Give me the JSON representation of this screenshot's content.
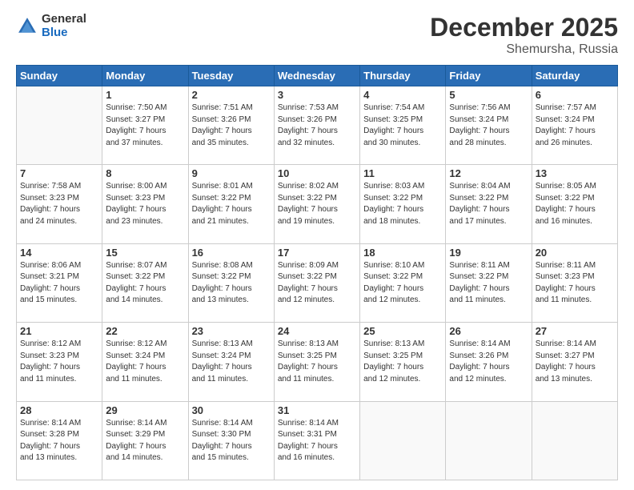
{
  "header": {
    "logo": {
      "general": "General",
      "blue": "Blue"
    },
    "title": "December 2025",
    "location": "Shemursha, Russia"
  },
  "weekdays": [
    "Sunday",
    "Monday",
    "Tuesday",
    "Wednesday",
    "Thursday",
    "Friday",
    "Saturday"
  ],
  "weeks": [
    [
      {
        "day": "",
        "info": ""
      },
      {
        "day": "1",
        "info": "Sunrise: 7:50 AM\nSunset: 3:27 PM\nDaylight: 7 hours\nand 37 minutes."
      },
      {
        "day": "2",
        "info": "Sunrise: 7:51 AM\nSunset: 3:26 PM\nDaylight: 7 hours\nand 35 minutes."
      },
      {
        "day": "3",
        "info": "Sunrise: 7:53 AM\nSunset: 3:26 PM\nDaylight: 7 hours\nand 32 minutes."
      },
      {
        "day": "4",
        "info": "Sunrise: 7:54 AM\nSunset: 3:25 PM\nDaylight: 7 hours\nand 30 minutes."
      },
      {
        "day": "5",
        "info": "Sunrise: 7:56 AM\nSunset: 3:24 PM\nDaylight: 7 hours\nand 28 minutes."
      },
      {
        "day": "6",
        "info": "Sunrise: 7:57 AM\nSunset: 3:24 PM\nDaylight: 7 hours\nand 26 minutes."
      }
    ],
    [
      {
        "day": "7",
        "info": "Sunrise: 7:58 AM\nSunset: 3:23 PM\nDaylight: 7 hours\nand 24 minutes."
      },
      {
        "day": "8",
        "info": "Sunrise: 8:00 AM\nSunset: 3:23 PM\nDaylight: 7 hours\nand 23 minutes."
      },
      {
        "day": "9",
        "info": "Sunrise: 8:01 AM\nSunset: 3:22 PM\nDaylight: 7 hours\nand 21 minutes."
      },
      {
        "day": "10",
        "info": "Sunrise: 8:02 AM\nSunset: 3:22 PM\nDaylight: 7 hours\nand 19 minutes."
      },
      {
        "day": "11",
        "info": "Sunrise: 8:03 AM\nSunset: 3:22 PM\nDaylight: 7 hours\nand 18 minutes."
      },
      {
        "day": "12",
        "info": "Sunrise: 8:04 AM\nSunset: 3:22 PM\nDaylight: 7 hours\nand 17 minutes."
      },
      {
        "day": "13",
        "info": "Sunrise: 8:05 AM\nSunset: 3:22 PM\nDaylight: 7 hours\nand 16 minutes."
      }
    ],
    [
      {
        "day": "14",
        "info": "Sunrise: 8:06 AM\nSunset: 3:21 PM\nDaylight: 7 hours\nand 15 minutes."
      },
      {
        "day": "15",
        "info": "Sunrise: 8:07 AM\nSunset: 3:22 PM\nDaylight: 7 hours\nand 14 minutes."
      },
      {
        "day": "16",
        "info": "Sunrise: 8:08 AM\nSunset: 3:22 PM\nDaylight: 7 hours\nand 13 minutes."
      },
      {
        "day": "17",
        "info": "Sunrise: 8:09 AM\nSunset: 3:22 PM\nDaylight: 7 hours\nand 12 minutes."
      },
      {
        "day": "18",
        "info": "Sunrise: 8:10 AM\nSunset: 3:22 PM\nDaylight: 7 hours\nand 12 minutes."
      },
      {
        "day": "19",
        "info": "Sunrise: 8:11 AM\nSunset: 3:22 PM\nDaylight: 7 hours\nand 11 minutes."
      },
      {
        "day": "20",
        "info": "Sunrise: 8:11 AM\nSunset: 3:23 PM\nDaylight: 7 hours\nand 11 minutes."
      }
    ],
    [
      {
        "day": "21",
        "info": "Sunrise: 8:12 AM\nSunset: 3:23 PM\nDaylight: 7 hours\nand 11 minutes."
      },
      {
        "day": "22",
        "info": "Sunrise: 8:12 AM\nSunset: 3:24 PM\nDaylight: 7 hours\nand 11 minutes."
      },
      {
        "day": "23",
        "info": "Sunrise: 8:13 AM\nSunset: 3:24 PM\nDaylight: 7 hours\nand 11 minutes."
      },
      {
        "day": "24",
        "info": "Sunrise: 8:13 AM\nSunset: 3:25 PM\nDaylight: 7 hours\nand 11 minutes."
      },
      {
        "day": "25",
        "info": "Sunrise: 8:13 AM\nSunset: 3:25 PM\nDaylight: 7 hours\nand 12 minutes."
      },
      {
        "day": "26",
        "info": "Sunrise: 8:14 AM\nSunset: 3:26 PM\nDaylight: 7 hours\nand 12 minutes."
      },
      {
        "day": "27",
        "info": "Sunrise: 8:14 AM\nSunset: 3:27 PM\nDaylight: 7 hours\nand 13 minutes."
      }
    ],
    [
      {
        "day": "28",
        "info": "Sunrise: 8:14 AM\nSunset: 3:28 PM\nDaylight: 7 hours\nand 13 minutes."
      },
      {
        "day": "29",
        "info": "Sunrise: 8:14 AM\nSunset: 3:29 PM\nDaylight: 7 hours\nand 14 minutes."
      },
      {
        "day": "30",
        "info": "Sunrise: 8:14 AM\nSunset: 3:30 PM\nDaylight: 7 hours\nand 15 minutes."
      },
      {
        "day": "31",
        "info": "Sunrise: 8:14 AM\nSunset: 3:31 PM\nDaylight: 7 hours\nand 16 minutes."
      },
      {
        "day": "",
        "info": ""
      },
      {
        "day": "",
        "info": ""
      },
      {
        "day": "",
        "info": ""
      }
    ]
  ]
}
